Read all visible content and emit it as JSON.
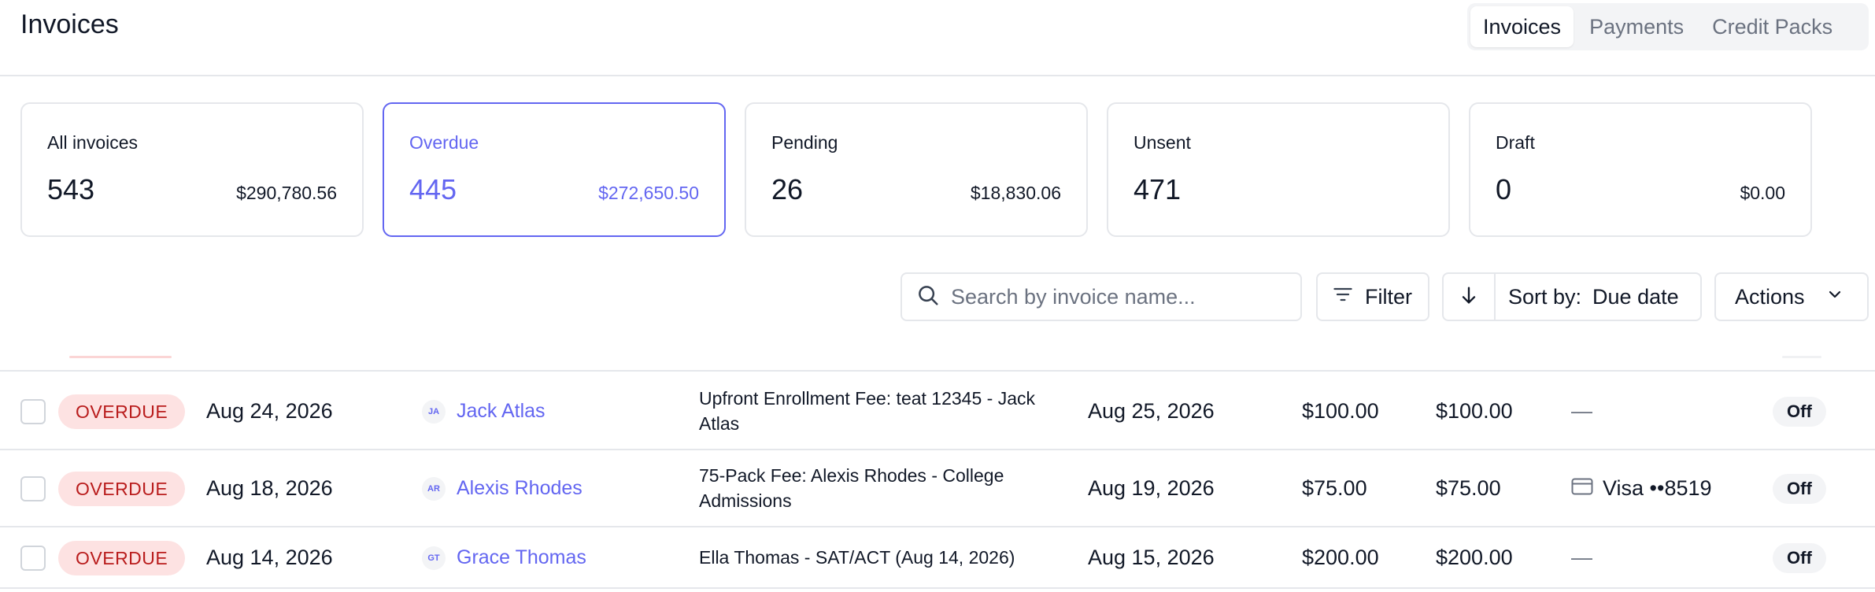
{
  "header": {
    "title": "Invoices",
    "tabs": [
      {
        "label": "Invoices",
        "active": true
      },
      {
        "label": "Payments",
        "active": false
      },
      {
        "label": "Credit Packs",
        "active": false
      }
    ]
  },
  "summary": [
    {
      "label": "All invoices",
      "count": "543",
      "amount": "$290,780.56",
      "active": false
    },
    {
      "label": "Overdue",
      "count": "445",
      "amount": "$272,650.50",
      "active": true
    },
    {
      "label": "Pending",
      "count": "26",
      "amount": "$18,830.06",
      "active": false
    },
    {
      "label": "Unsent",
      "count": "471",
      "amount": "",
      "active": false
    },
    {
      "label": "Draft",
      "count": "0",
      "amount": "$0.00",
      "active": false
    }
  ],
  "toolbar": {
    "search_placeholder": "Search by invoice name...",
    "filter_label": "Filter",
    "sort_prefix": "Sort by:",
    "sort_value": "Due date",
    "actions_label": "Actions"
  },
  "rows": [
    {
      "status": "OVERDUE",
      "issue_date": "Aug 24, 2026",
      "initials": "JA",
      "name": "Jack Atlas",
      "description": "Upfront Enrollment Fee: teat 12345 - Jack Atlas",
      "due_date": "Aug 25, 2026",
      "amount": "$100.00",
      "balance": "$100.00",
      "payment_method": "",
      "payment_empty": "—",
      "autopay": "Off"
    },
    {
      "status": "OVERDUE",
      "issue_date": "Aug 18, 2026",
      "initials": "AR",
      "name": "Alexis Rhodes",
      "description": "75-Pack Fee: Alexis Rhodes - College Admissions",
      "due_date": "Aug 19, 2026",
      "amount": "$75.00",
      "balance": "$75.00",
      "payment_method": "Visa ••8519",
      "payment_empty": "",
      "autopay": "Off"
    },
    {
      "status": "OVERDUE",
      "issue_date": "Aug 14, 2026",
      "initials": "GT",
      "name": "Grace Thomas",
      "description": "Ella Thomas - SAT/ACT (Aug 14, 2026)",
      "due_date": "Aug 15, 2026",
      "amount": "$200.00",
      "balance": "$200.00",
      "payment_method": "",
      "payment_empty": "—",
      "autopay": "Off"
    }
  ],
  "colors": {
    "accent": "#6366f1",
    "overdue_bg": "#fde2e2",
    "overdue_text": "#b91c1c",
    "border": "#e5e7eb"
  }
}
